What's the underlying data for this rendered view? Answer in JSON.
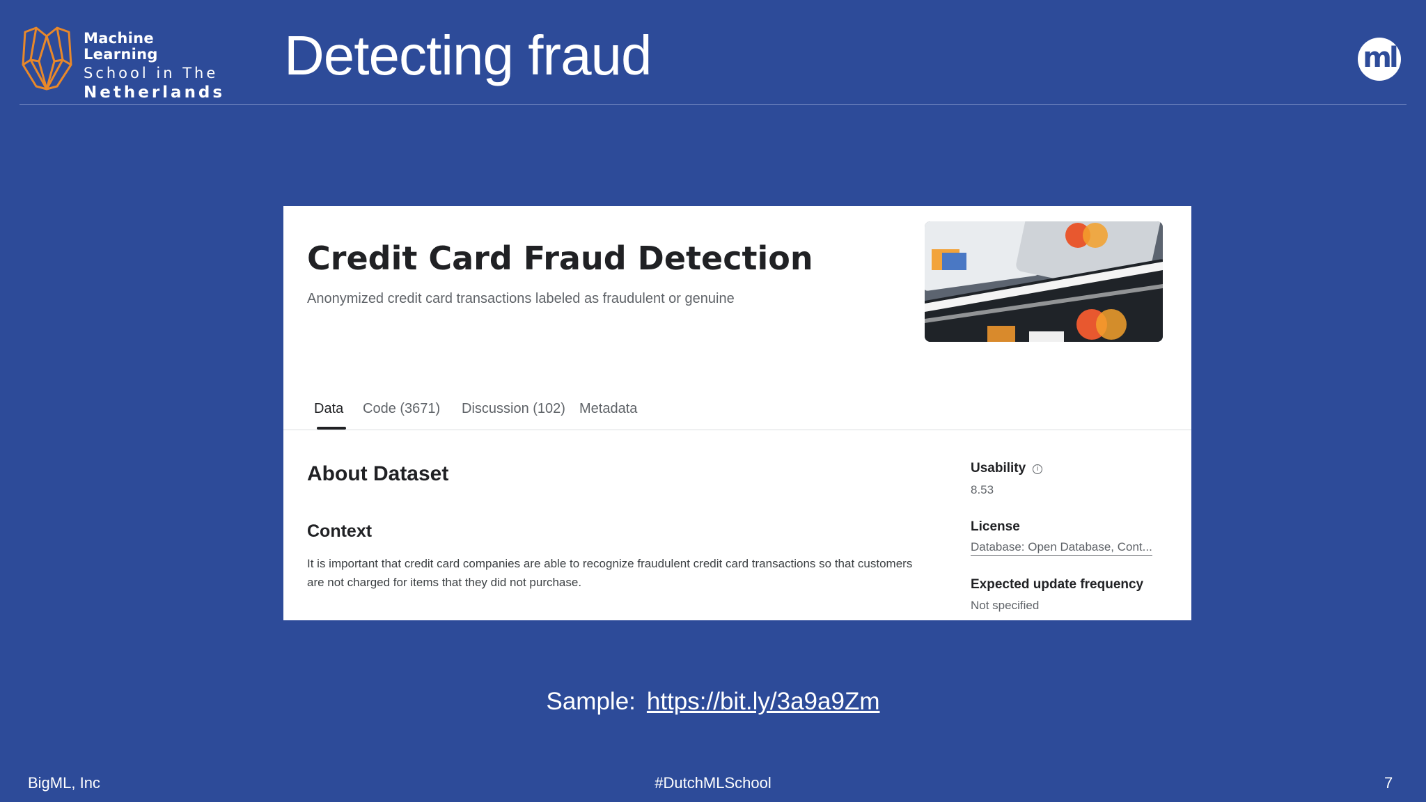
{
  "slide": {
    "title": "Detecting fraud",
    "logo": {
      "line1": "Machine Learning",
      "line2": "School in The",
      "line3": "Netherlands"
    },
    "corner_logo": "ml",
    "sample_label": "Sample:",
    "sample_link": "https://bit.ly/3a9a9Zm",
    "footer_left": "BigML, Inc",
    "footer_center": "#DutchMLSchool",
    "page_number": "7"
  },
  "dataset": {
    "title": "Credit Card Fraud Detection",
    "subtitle": "Anonymized credit card transactions labeled as fraudulent or genuine",
    "tabs": [
      {
        "label": "Data",
        "active": true
      },
      {
        "label": "Code (3671)",
        "active": false
      },
      {
        "label": "Discussion (102)",
        "active": false
      },
      {
        "label": "Metadata",
        "active": false
      }
    ],
    "about_heading": "About Dataset",
    "context_heading": "Context",
    "context_text": "It is important that credit card companies are able to recognize fraudulent credit card transactions so that customers are not charged for items that they did not purchase.",
    "usability_label": "Usability",
    "usability_value": "8.53",
    "license_label": "License",
    "license_value": "Database: Open Database, Cont...",
    "update_label": "Expected update frequency",
    "update_value": "Not specified"
  },
  "colors": {
    "background": "#2d4b99",
    "logo_orange": "#e8882a"
  }
}
